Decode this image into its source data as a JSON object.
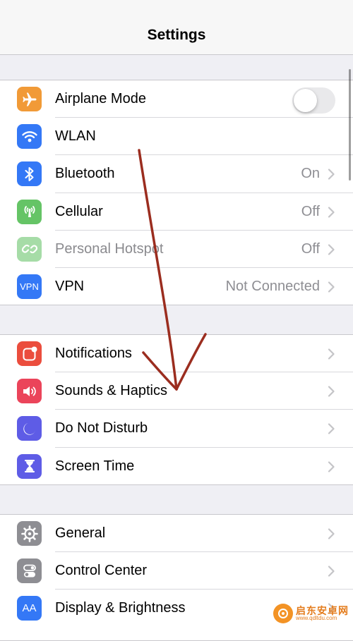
{
  "header": {
    "title": "Settings"
  },
  "groups": [
    {
      "rows": [
        {
          "id": "airplane-mode",
          "label": "Airplane Mode",
          "icon": "airplane-icon",
          "icon_color": "#f19a37",
          "control": "toggle",
          "toggle_on": false
        },
        {
          "id": "wlan",
          "label": "WLAN",
          "icon": "wifi-icon",
          "icon_color": "#3478f6",
          "value": ""
        },
        {
          "id": "bluetooth",
          "label": "Bluetooth",
          "icon": "bluetooth-icon",
          "icon_color": "#3478f6",
          "value": "On"
        },
        {
          "id": "cellular",
          "label": "Cellular",
          "icon": "antenna-icon",
          "icon_color": "#65c466",
          "value": "Off"
        },
        {
          "id": "personal-hotspot",
          "label": "Personal Hotspot",
          "icon": "hotspot-icon",
          "icon_color": "#a6dca7",
          "value": "Off",
          "disabled": true
        },
        {
          "id": "vpn",
          "label": "VPN",
          "icon": "vpn-icon",
          "icon_text": "VPN",
          "icon_color": "#3478f6",
          "value": "Not Connected"
        }
      ]
    },
    {
      "rows": [
        {
          "id": "notifications",
          "label": "Notifications",
          "icon": "notifications-icon",
          "icon_color": "#eb4d3d"
        },
        {
          "id": "sounds-haptics",
          "label": "Sounds & Haptics",
          "icon": "speaker-icon",
          "icon_color": "#eb445a"
        },
        {
          "id": "do-not-disturb",
          "label": "Do Not Disturb",
          "icon": "moon-icon",
          "icon_color": "#5e5ce6"
        },
        {
          "id": "screen-time",
          "label": "Screen Time",
          "icon": "hourglass-icon",
          "icon_color": "#5e5ce6"
        }
      ]
    },
    {
      "rows": [
        {
          "id": "general",
          "label": "General",
          "icon": "gear-icon",
          "icon_color": "#8e8e93"
        },
        {
          "id": "control-center",
          "label": "Control Center",
          "icon": "switches-icon",
          "icon_color": "#8e8e93"
        },
        {
          "id": "display-brightness",
          "label": "Display & Brightness",
          "icon": "display-icon",
          "icon_text": "AA",
          "icon_color": "#3478f6"
        }
      ]
    }
  ],
  "watermark": {
    "brand": "启东安卓网",
    "url": "www.qdltdu.com",
    "color": "#f39325"
  },
  "annotation": {
    "color": "#9b2d1f"
  }
}
